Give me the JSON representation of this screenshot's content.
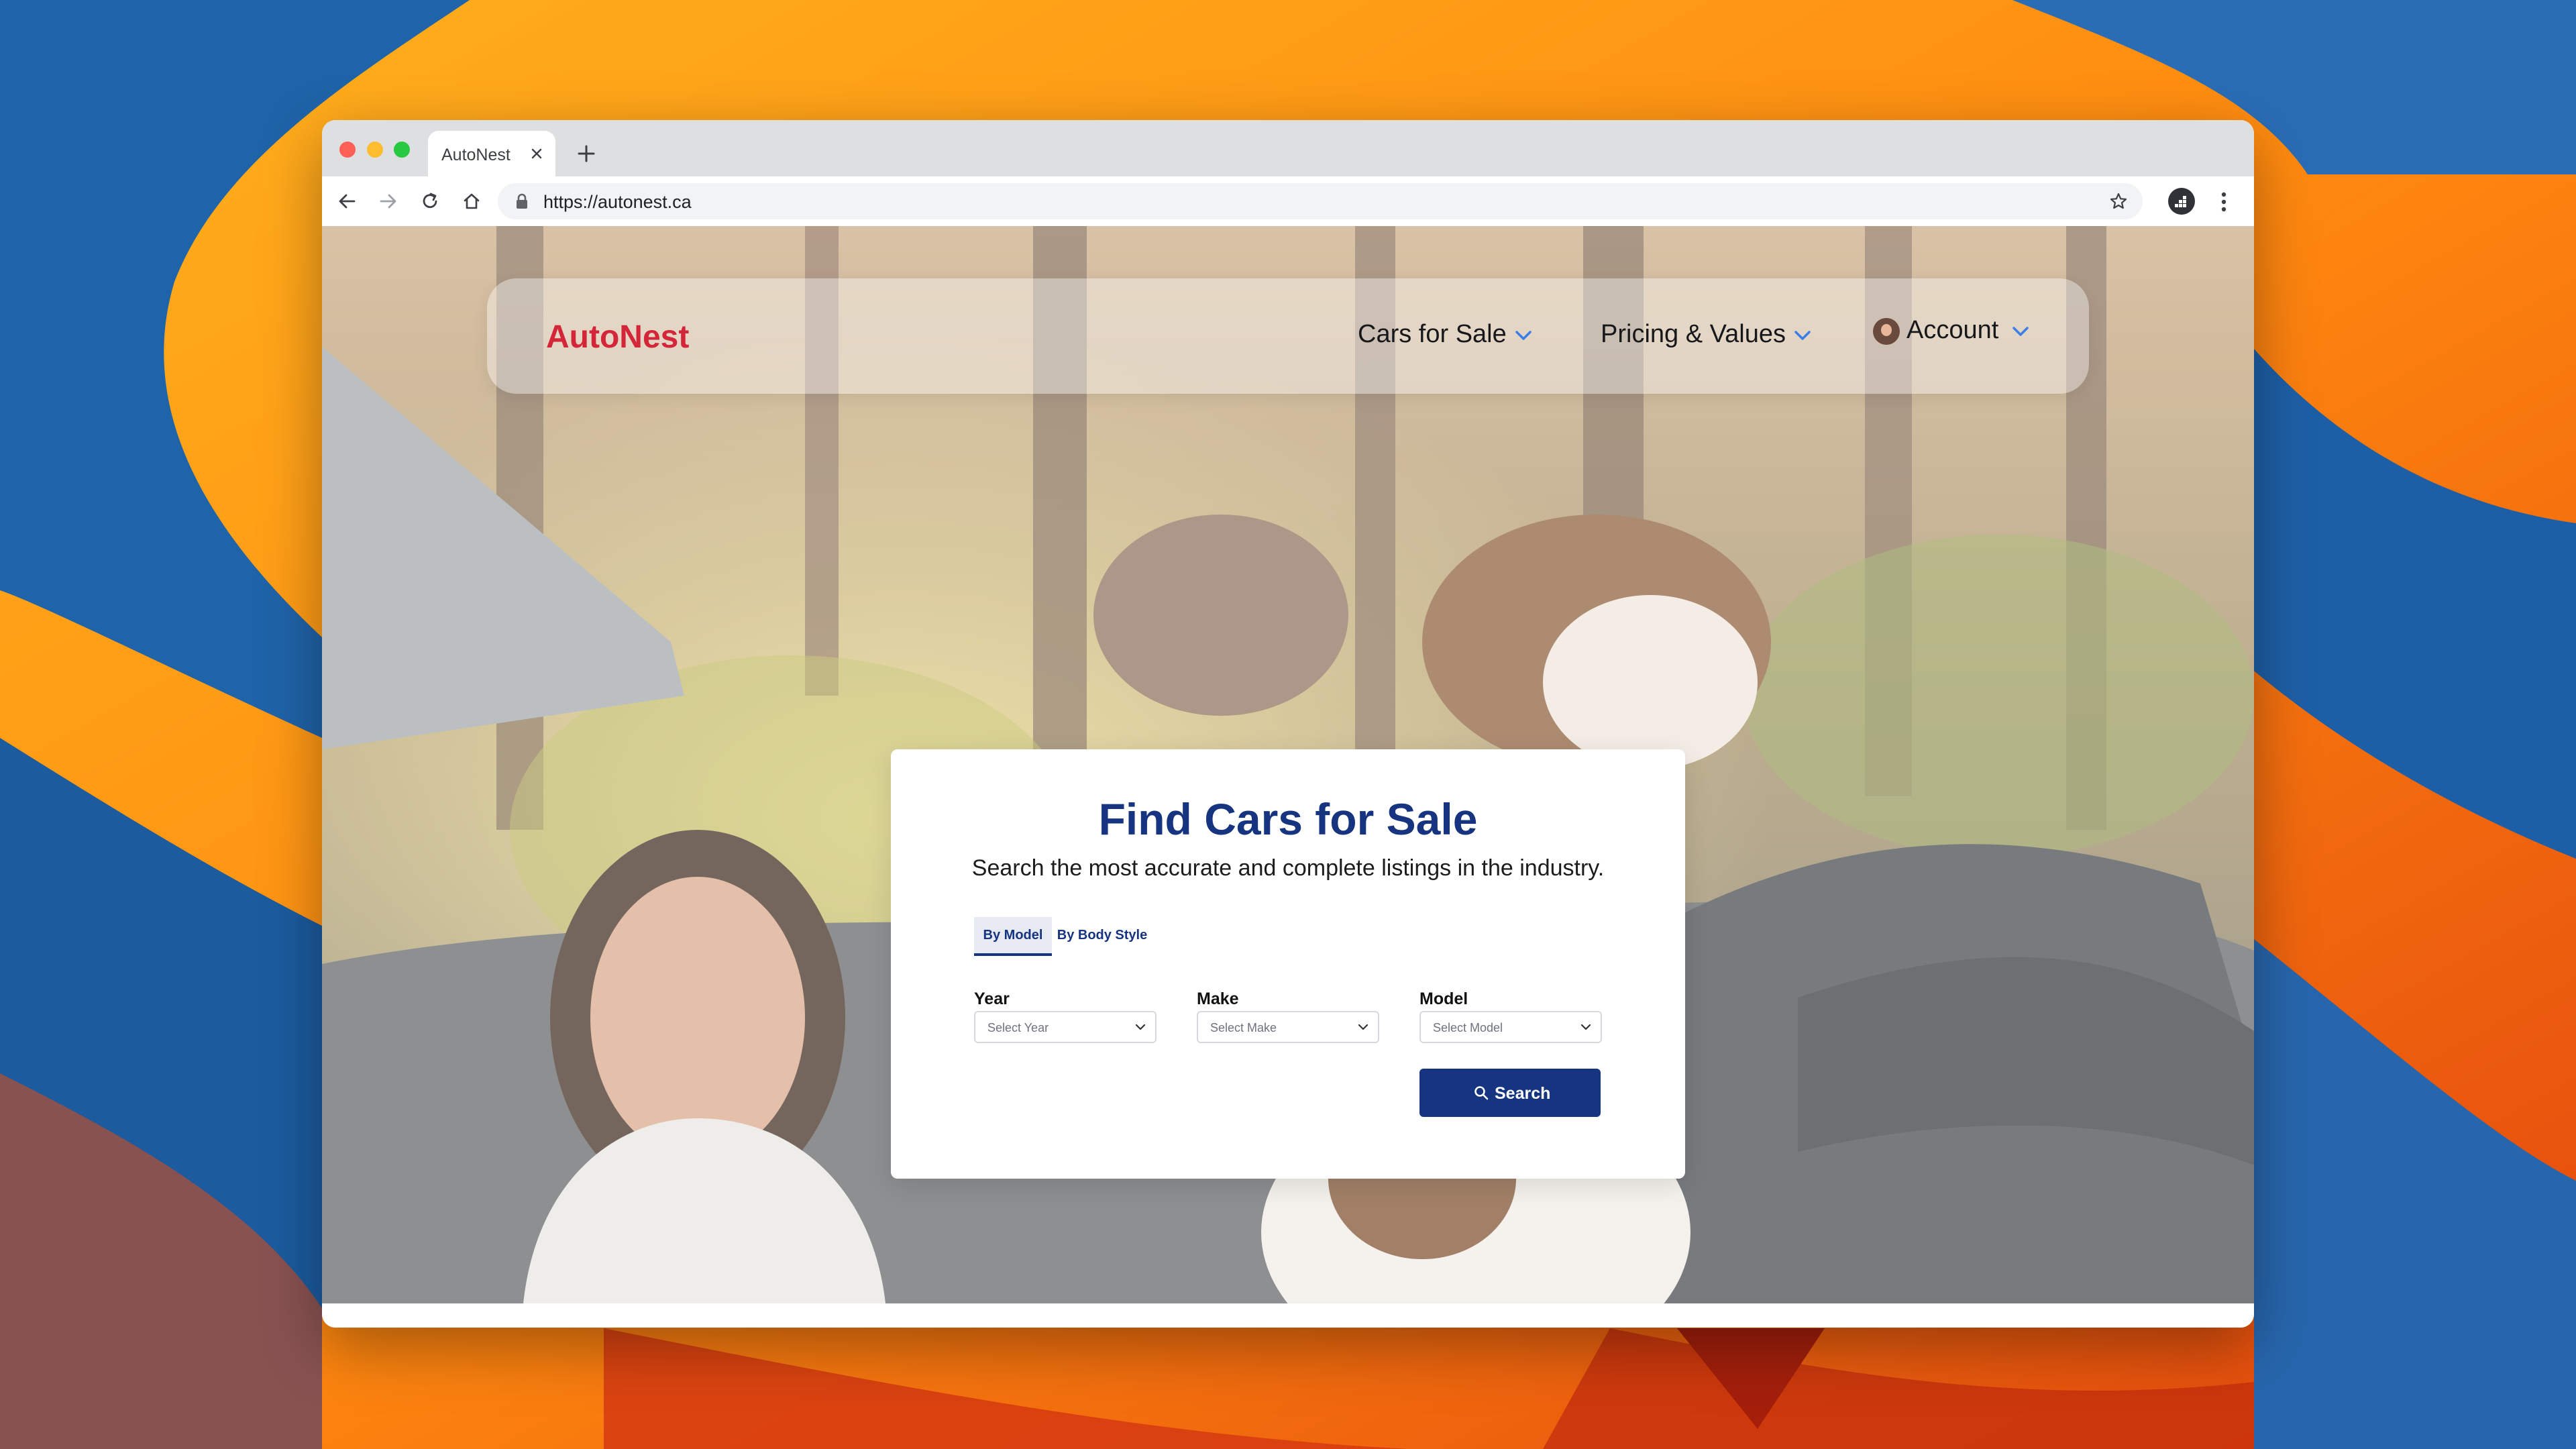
{
  "browser": {
    "tab_title": "AutoNest",
    "url": "https://autonest.ca"
  },
  "site": {
    "logo": "AutoNest",
    "nav": {
      "cars_for_sale": "Cars for Sale",
      "pricing_values": "Pricing & Values",
      "account": "Account"
    }
  },
  "search": {
    "title": "Find Cars for Sale",
    "subtitle": "Search the most accurate and complete listings in the industry.",
    "tabs": [
      "By Model",
      "By Body Style"
    ],
    "active_tab": "By Model",
    "fields": {
      "year": {
        "label": "Year",
        "placeholder": "Select Year"
      },
      "make": {
        "label": "Make",
        "placeholder": "Select Make"
      },
      "model": {
        "label": "Model",
        "placeholder": "Select Model"
      }
    },
    "button": "Search"
  },
  "colors": {
    "brand_red": "#d32639",
    "brand_navy": "#16347f",
    "nav_chevron": "#3d7de8"
  },
  "icons": [
    "back-icon",
    "forward-icon",
    "reload-icon",
    "home-icon",
    "lock-icon",
    "star-icon",
    "extension-icon",
    "more-vert-icon",
    "close-icon",
    "plus-icon",
    "chevron-down-icon",
    "search-icon"
  ]
}
